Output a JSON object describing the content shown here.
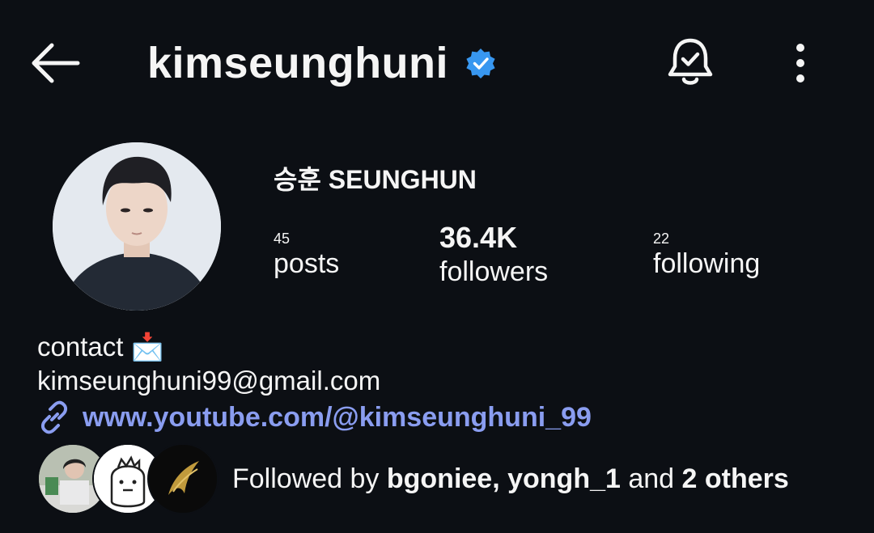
{
  "header": {
    "username": "kimseunghuni",
    "verified": true,
    "back_icon": "back-arrow-icon",
    "bell_icon": "bell-check-icon",
    "more_icon": "more-vertical-icon"
  },
  "profile": {
    "display_name": "승훈 SEUNGHUN",
    "stats": {
      "posts": {
        "value": "45",
        "label": "posts"
      },
      "followers": {
        "value": "36.4K",
        "label": "followers"
      },
      "following": {
        "value": "22",
        "label": "following"
      }
    },
    "bio": {
      "line1": "contact 📩",
      "line2": "kimseunghuni99@gmail.com"
    },
    "link": "www.youtube.com/@kimseunghuni_99",
    "followed_by": {
      "prefix": "Followed by ",
      "names": "bgoniee, yongh_1",
      "middle": " and ",
      "others": "2 others"
    }
  },
  "colors": {
    "background": "#0c0f14",
    "text": "#f5f5f5",
    "link": "#8a9df0",
    "verified": "#3897f0"
  }
}
